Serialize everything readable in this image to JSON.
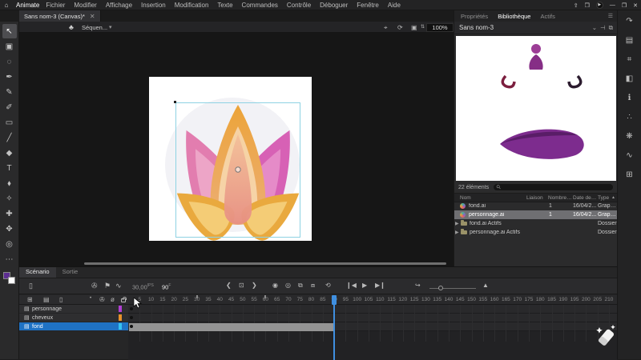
{
  "menubar": {
    "app": "Animate",
    "menus": [
      "Fichier",
      "Modifier",
      "Affichage",
      "Insertion",
      "Modification",
      "Texte",
      "Commandes",
      "Contrôle",
      "Déboguer",
      "Fenêtre",
      "Aide"
    ],
    "window_buttons": {
      "minimize": "—",
      "restore": "❐",
      "close": "✕"
    }
  },
  "document_tab": {
    "title": "Sans nom-3 (Canvas)*",
    "close": "✕"
  },
  "edit_bar": {
    "scene_label": "Séquen...",
    "zoom_value": "100%"
  },
  "toolbar": {
    "tools": [
      {
        "name": "selection-tool",
        "glyph": "↖",
        "active": true
      },
      {
        "name": "free-transform-tool",
        "glyph": "▣",
        "active": false
      },
      {
        "name": "lasso-tool",
        "glyph": "◌",
        "active": false
      },
      {
        "name": "pen-tool",
        "glyph": "✒",
        "active": false
      },
      {
        "name": "pencil-tool",
        "glyph": "✎",
        "active": false
      },
      {
        "name": "brush-tool",
        "glyph": "✐",
        "active": false
      },
      {
        "name": "rectangle-tool",
        "glyph": "▭",
        "active": false
      },
      {
        "name": "line-tool",
        "glyph": "╱",
        "active": false
      },
      {
        "name": "paint-bucket-tool",
        "glyph": "◆",
        "active": false
      },
      {
        "name": "text-tool",
        "glyph": "T",
        "active": false
      },
      {
        "name": "ink-bottle-tool",
        "glyph": "⬧",
        "active": false
      },
      {
        "name": "eyedropper-tool",
        "glyph": "✧",
        "active": false
      },
      {
        "name": "width-tool",
        "glyph": "✚",
        "active": false
      },
      {
        "name": "hand-tool",
        "glyph": "✥",
        "active": false
      },
      {
        "name": "zoom-tool",
        "glyph": "◎",
        "active": false
      },
      {
        "name": "more-tools",
        "glyph": "⋯",
        "active": false
      }
    ]
  },
  "library": {
    "tabs": [
      "Propriétés",
      "Bibliothèque",
      "Actifs"
    ],
    "active_tab": "Bibliothèque",
    "document_name": "Sans nom-3",
    "item_count": "22 éléments",
    "columns": {
      "name": "Nom",
      "linkage": "Liaison",
      "use_count": "Nombre d'u...",
      "modified": "Date de mo...",
      "type": "Type",
      "sort_arrow": "▲"
    },
    "items": [
      {
        "name": "fond.ai",
        "use_count": "1",
        "modified": "16/04/2...",
        "type": "Graphique"
      },
      {
        "name": "personnage.ai",
        "use_count": "1",
        "modified": "16/04/2...",
        "type": "Graphique"
      },
      {
        "name": "fond.ai Actifs",
        "type": "Dossier"
      },
      {
        "name": "personnage.ai Actifs",
        "type": "Dossier"
      }
    ]
  },
  "dock": {
    "icons": [
      {
        "name": "history-icon",
        "glyph": "↷"
      },
      {
        "name": "align-icon",
        "glyph": "▤"
      },
      {
        "name": "transform-icon",
        "glyph": "⌗"
      },
      {
        "name": "color-icon",
        "glyph": "◧"
      },
      {
        "name": "info-icon",
        "glyph": "ℹ"
      },
      {
        "name": "fluid-brush-icon",
        "glyph": "∴"
      },
      {
        "name": "paint-icon",
        "glyph": "❋"
      },
      {
        "name": "motion-editor-icon",
        "glyph": "∿"
      },
      {
        "name": "components-icon",
        "glyph": "⊞"
      }
    ]
  },
  "timeline": {
    "tabs": [
      "Scénario",
      "Sortie"
    ],
    "fps_value": "30,00",
    "fps_unit": "IPS",
    "frame_value": "90",
    "frame_unit": "F",
    "layers": [
      {
        "name": "personnage",
        "color": "#b13fd4",
        "selected": false
      },
      {
        "name": "cheveux",
        "color": "#e8922a",
        "selected": false
      },
      {
        "name": "fond",
        "color": "#35c3f0",
        "selected": true
      }
    ],
    "ruler": {
      "label_step": 5,
      "max_frame": 210,
      "frame_width": 2.857,
      "seconds_ticks": [
        30,
        60
      ]
    },
    "playhead_frame": 90,
    "fond_span": {
      "from": 1,
      "to": 90
    }
  }
}
